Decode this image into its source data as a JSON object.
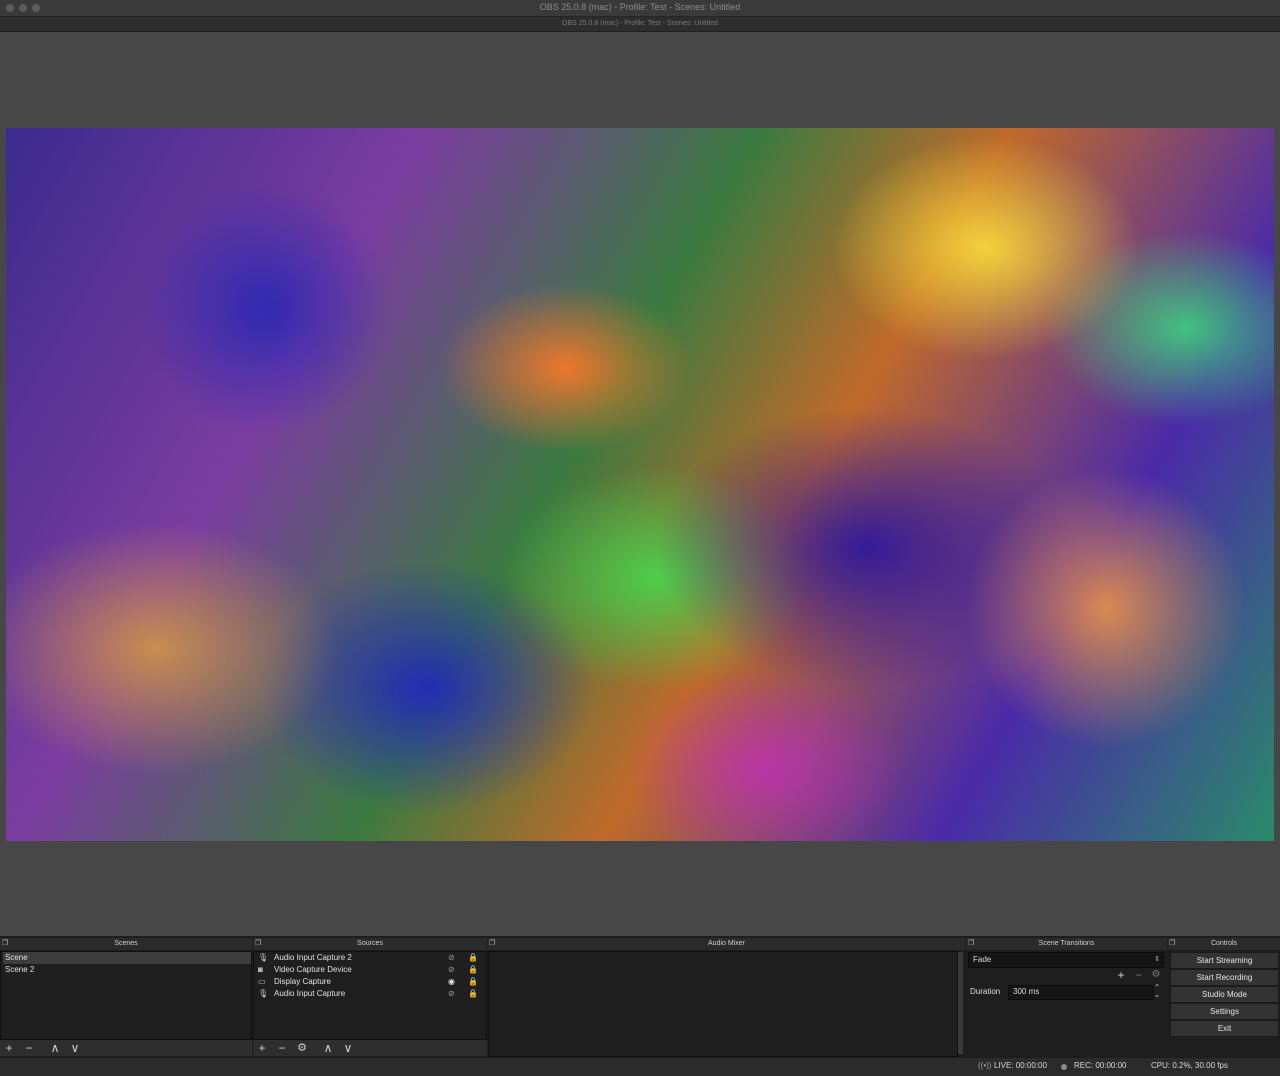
{
  "window": {
    "title": "OBS 25.0.8 (mac) - Profile: Test - Scenes: Untitled",
    "subtitle": "OBS 25.0.8 (mac) - Profile: Test - Scenes: Untitled"
  },
  "docks": {
    "scenes": "Scenes",
    "sources": "Sources",
    "audio_mixer": "Audio Mixer",
    "scene_transitions": "Scene Transitions",
    "controls": "Controls"
  },
  "scenes": {
    "items": [
      {
        "label": "Scene",
        "selected": true
      },
      {
        "label": "Scene 2",
        "selected": false
      }
    ],
    "toolbar": {
      "add": "+",
      "remove": "−",
      "up": "∧",
      "down": "∨"
    }
  },
  "sources": {
    "items": [
      {
        "label": "Audio Input Capture 2",
        "icon": "microphone-icon",
        "visible": false
      },
      {
        "label": "Video Capture Device",
        "icon": "camera-icon",
        "visible": false
      },
      {
        "label": "Display Capture",
        "icon": "monitor-icon",
        "visible": true
      },
      {
        "label": "Audio Input Capture",
        "icon": "microphone-icon",
        "visible": false
      }
    ],
    "toolbar": {
      "add": "+",
      "remove": "−",
      "settings": "⚙",
      "up": "∧",
      "down": "∨"
    }
  },
  "transitions": {
    "selected": "Fade",
    "duration_label": "Duration",
    "duration_value": "300 ms"
  },
  "controls": {
    "start_streaming": "Start Streaming",
    "start_recording": "Start Recording",
    "studio_mode": "Studio Mode",
    "settings": "Settings",
    "exit": "Exit"
  },
  "status": {
    "live": "LIVE: 00:00:00",
    "rec": "REC: 00:00:00",
    "cpu": "CPU: 0.2%, 30.00 fps"
  }
}
